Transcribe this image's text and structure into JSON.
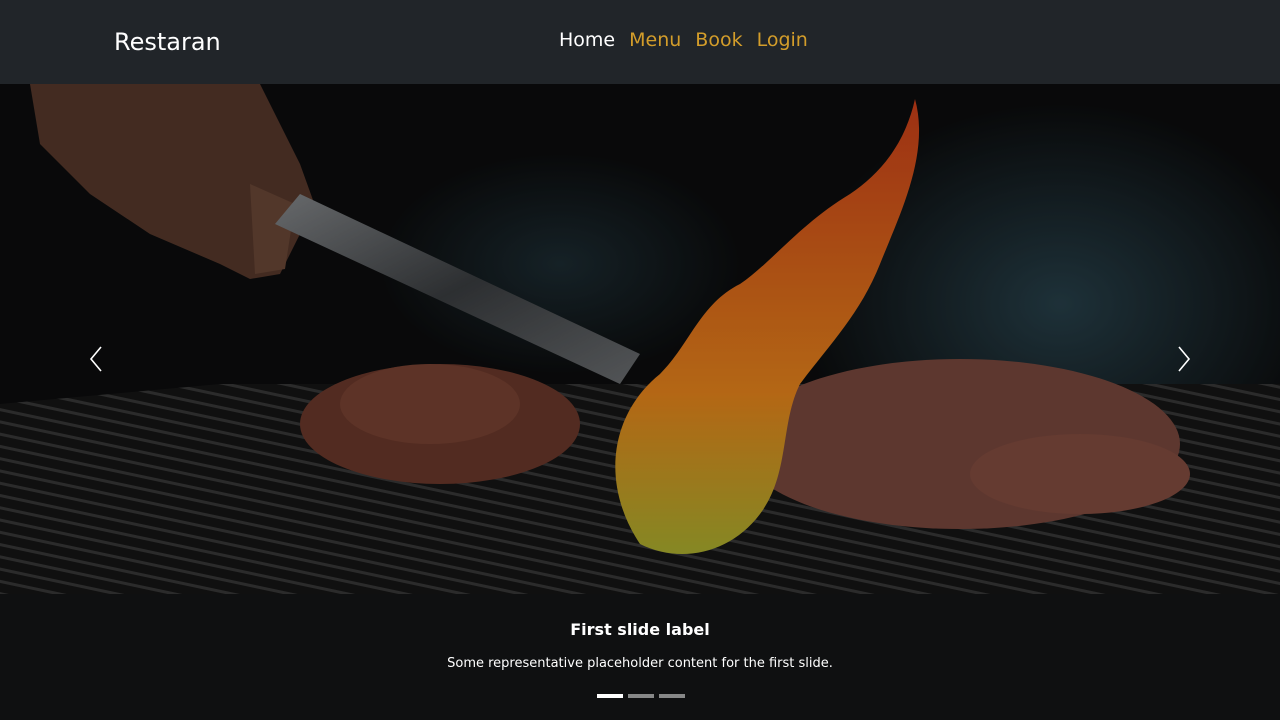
{
  "navbar": {
    "brand": "Restaran",
    "links": [
      {
        "label": "Home",
        "active": true
      },
      {
        "label": "Menu",
        "active": false
      },
      {
        "label": "Book",
        "active": false
      },
      {
        "label": "Login",
        "active": false
      }
    ],
    "accent_color": "#d39d2a",
    "background_color": "#212529"
  },
  "carousel": {
    "slide": {
      "title": "First slide label",
      "text": "Some representative placeholder content for the first slide."
    },
    "slide_count": 3,
    "active_index": 0,
    "prev_icon": "chevron-left-icon",
    "next_icon": "chevron-right-icon"
  }
}
